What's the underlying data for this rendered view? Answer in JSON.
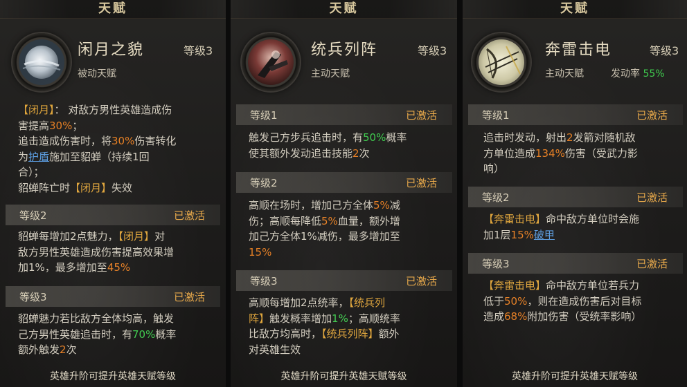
{
  "panels": [
    {
      "title": "天赋",
      "name": "闲月之貌",
      "level": "等级3",
      "type": "被动天赋",
      "desc": [
        [
          {
            "t": "【闭月】",
            "c": "gold"
          },
          {
            "t": "： 对敌方男性英雄造成伤"
          }
        ],
        [
          {
            "t": "害提高"
          },
          {
            "t": "30%",
            "c": "orange"
          },
          {
            "t": "；"
          }
        ],
        [
          {
            "t": "追击造成伤害时，将"
          },
          {
            "t": "30%",
            "c": "orange"
          },
          {
            "t": "伤害转化"
          }
        ],
        [
          {
            "t": "为"
          },
          {
            "t": "护盾",
            "c": "blue"
          },
          {
            "t": "施加至貂蝉（持续1回"
          }
        ],
        [
          {
            "t": "合）；"
          }
        ],
        [
          {
            "t": "貂蝉阵亡时"
          },
          {
            "t": "【闭月】",
            "c": "gold"
          },
          {
            "t": "失效"
          }
        ]
      ],
      "levels": [
        {
          "label": "等级2",
          "status": "已激活",
          "text": [
            [
              {
                "t": "貂蝉每增加2点魅力，"
              },
              {
                "t": "【闭月】",
                "c": "gold"
              },
              {
                "t": "对"
              }
            ],
            [
              {
                "t": "敌方男性英雄造成伤害提高效果增"
              }
            ],
            [
              {
                "t": "加1%，最多增加至"
              },
              {
                "t": "45%",
                "c": "orange"
              }
            ]
          ]
        },
        {
          "label": "等级3",
          "status": "已激活",
          "text": [
            [
              {
                "t": "貂蝉魅力若比敌方全体均高，触发"
              }
            ],
            [
              {
                "t": "己方男性英雄追击时，有"
              },
              {
                "t": "70%",
                "c": "green"
              },
              {
                "t": "概率"
              }
            ],
            [
              {
                "t": "额外触发"
              },
              {
                "t": "2",
                "c": "orange"
              },
              {
                "t": "次"
              }
            ]
          ]
        }
      ],
      "footer": "英雄升阶可提升英雄天赋等级"
    },
    {
      "title": "天赋",
      "name": "统兵列阵",
      "level": "等级3",
      "type": "主动天赋",
      "desc": [],
      "levels": [
        {
          "label": "等级1",
          "status": "已激活",
          "text": [
            [
              {
                "t": "触发己方步兵追击时，有"
              },
              {
                "t": "50%",
                "c": "green"
              },
              {
                "t": "概率"
              }
            ],
            [
              {
                "t": "使其额外发动追击技能"
              },
              {
                "t": "2",
                "c": "orange"
              },
              {
                "t": "次"
              }
            ]
          ]
        },
        {
          "label": "等级2",
          "status": "已激活",
          "text": [
            [
              {
                "t": "高顺在场时，增加己方全体"
              },
              {
                "t": "5%",
                "c": "orange"
              },
              {
                "t": "减"
              }
            ],
            [
              {
                "t": "伤；高顺每降低"
              },
              {
                "t": "5%",
                "c": "orange"
              },
              {
                "t": "血量，额外增"
              }
            ],
            [
              {
                "t": "加己方全体1%减伤，最多增加至"
              }
            ],
            [
              {
                "t": "15%",
                "c": "orange"
              }
            ]
          ]
        },
        {
          "label": "等级3",
          "status": "已激活",
          "text": [
            [
              {
                "t": "高顺每增加2点统率，"
              },
              {
                "t": "【统兵列",
                "c": "gold"
              }
            ],
            [
              {
                "t": "阵】",
                "c": "gold"
              },
              {
                "t": "触发概率增加"
              },
              {
                "t": "1%",
                "c": "green"
              },
              {
                "t": "；高顺统率"
              }
            ],
            [
              {
                "t": "比敌方均高时，"
              },
              {
                "t": "【统兵列阵】",
                "c": "gold"
              },
              {
                "t": "额外"
              }
            ],
            [
              {
                "t": "对英雄生效"
              }
            ]
          ]
        }
      ],
      "footer": "英雄升阶可提升英雄天赋等级"
    },
    {
      "title": "天赋",
      "name": "奔雷击电",
      "level": "等级3",
      "type": "主动天赋",
      "trigger_label": "发动率",
      "trigger_value": "55%",
      "desc": [],
      "levels": [
        {
          "label": "等级1",
          "status": "已激活",
          "text": [
            [
              {
                "t": "追击时发动，射出"
              },
              {
                "t": "2",
                "c": "orange"
              },
              {
                "t": "发箭对随机敌"
              }
            ],
            [
              {
                "t": "方单位造成"
              },
              {
                "t": "134%",
                "c": "orange"
              },
              {
                "t": "伤害（受武力影"
              }
            ],
            [
              {
                "t": "响）"
              }
            ]
          ]
        },
        {
          "label": "等级2",
          "status": "已激活",
          "text": [
            [
              {
                "t": "【奔雷击电】",
                "c": "gold"
              },
              {
                "t": "命中敌方单位时会施"
              }
            ],
            [
              {
                "t": "加1层"
              },
              {
                "t": "15%",
                "c": "orange"
              },
              {
                "t": "破甲",
                "c": "blue"
              }
            ]
          ]
        },
        {
          "label": "等级3",
          "status": "已激活",
          "text": [
            [
              {
                "t": "【奔雷击电】",
                "c": "gold"
              },
              {
                "t": "命中敌方单位若兵力"
              }
            ],
            [
              {
                "t": "低于"
              },
              {
                "t": "50%",
                "c": "orange"
              },
              {
                "t": "，则在造成伤害后对目标"
              }
            ],
            [
              {
                "t": "造成"
              },
              {
                "t": "68%",
                "c": "orange"
              },
              {
                "t": "附加伤害（受统率影响）"
              }
            ]
          ]
        }
      ],
      "footer": "英雄升阶可提升英雄天赋等级"
    }
  ],
  "icons": [
    "moon-portrait-icon",
    "warrior-portrait-icon",
    "bow-portrait-icon"
  ],
  "colors": {
    "gold": "#e0a53a",
    "orange": "#e67e22",
    "green": "#3fcc4e",
    "blue": "#5a9ce0"
  }
}
